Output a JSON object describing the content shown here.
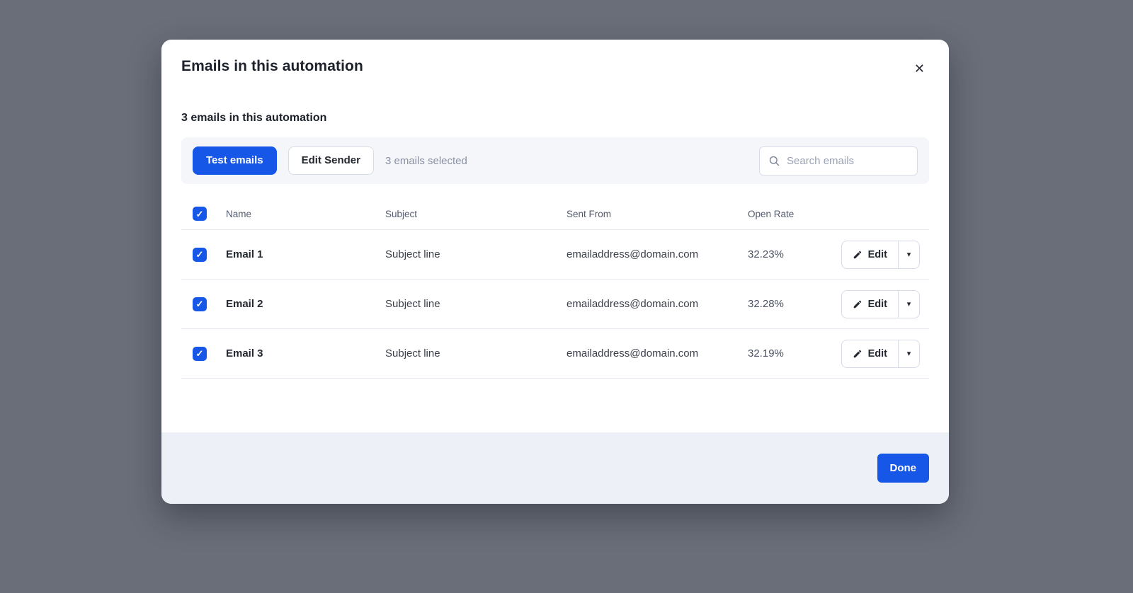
{
  "modal": {
    "title": "Emails in this automation",
    "subtitle": "3 emails in this automation",
    "toolbar": {
      "test_emails_label": "Test emails",
      "edit_sender_label": "Edit Sender",
      "selected_text": "3 emails selected",
      "search_placeholder": "Search emails"
    },
    "table": {
      "columns": [
        "Name",
        "Subject",
        "Sent From",
        "Open Rate"
      ],
      "rows": [
        {
          "checked": true,
          "name": "Email 1",
          "subject": "Subject line",
          "sent_from": "emailaddress@domain.com",
          "open_rate": "32.23%",
          "action_label": "Edit"
        },
        {
          "checked": true,
          "name": "Email 2",
          "subject": "Subject line",
          "sent_from": "emailaddress@domain.com",
          "open_rate": "32.28%",
          "action_label": "Edit"
        },
        {
          "checked": true,
          "name": "Email 3",
          "subject": "Subject line",
          "sent_from": "emailaddress@domain.com",
          "open_rate": "32.19%",
          "action_label": "Edit"
        }
      ]
    },
    "footer": {
      "done_label": "Done"
    }
  },
  "icons": {
    "close_glyph": "✕",
    "check_glyph": "✓",
    "caret_glyph": "▾"
  },
  "colors": {
    "accent_blue": "#1657e8",
    "overlay_background": "#6a6e79",
    "toolbar_background": "#f4f6fa",
    "footer_background": "#edf0f6",
    "divider": "#e8eaf1"
  }
}
